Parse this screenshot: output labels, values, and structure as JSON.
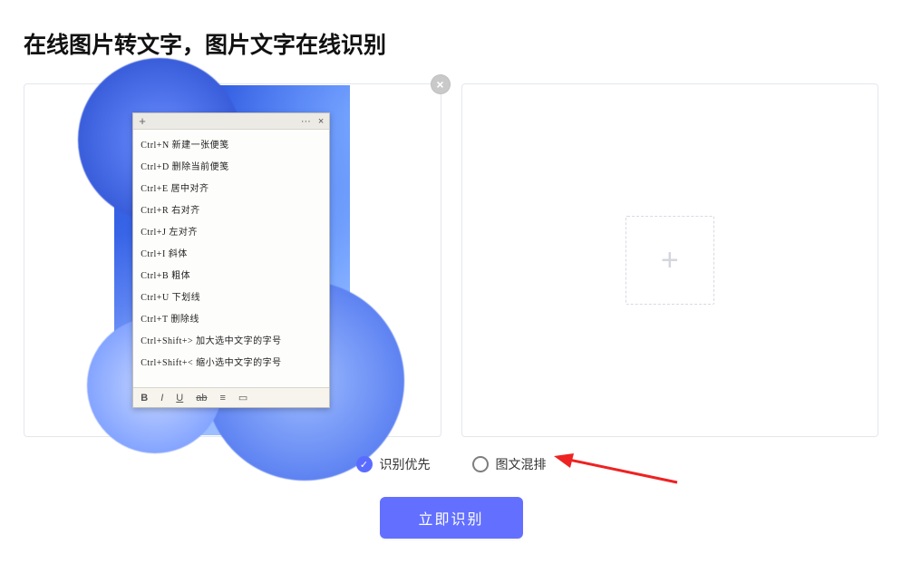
{
  "title": "在线图片转文字，图片文字在线识别",
  "preview": {
    "shortcuts": [
      "Ctrl+N 新建一张便笺",
      "Ctrl+D 删除当前便笺",
      "Ctrl+E 居中对齐",
      "Ctrl+R 右对齐",
      "Ctrl+J 左对齐",
      "Ctrl+I 斜体",
      "Ctrl+B 粗体",
      "Ctrl+U 下划线",
      "Ctrl+T 删除线",
      "Ctrl+Shift+> 加大选中文字的字号",
      "Ctrl+Shift+< 缩小选中文字的字号"
    ],
    "toolbar": {
      "b": "B",
      "i": "I",
      "u": "U",
      "s": "ab",
      "list": "≡",
      "img": "▭"
    },
    "titlebar": {
      "plus": "+",
      "more": "···",
      "close": "×"
    },
    "close_badge": "×"
  },
  "drop": {
    "plus": "+"
  },
  "options": {
    "recognition_first": "识别优先",
    "mixed_layout": "图文混排",
    "check": "✓"
  },
  "cta": {
    "label": "立即识别"
  }
}
